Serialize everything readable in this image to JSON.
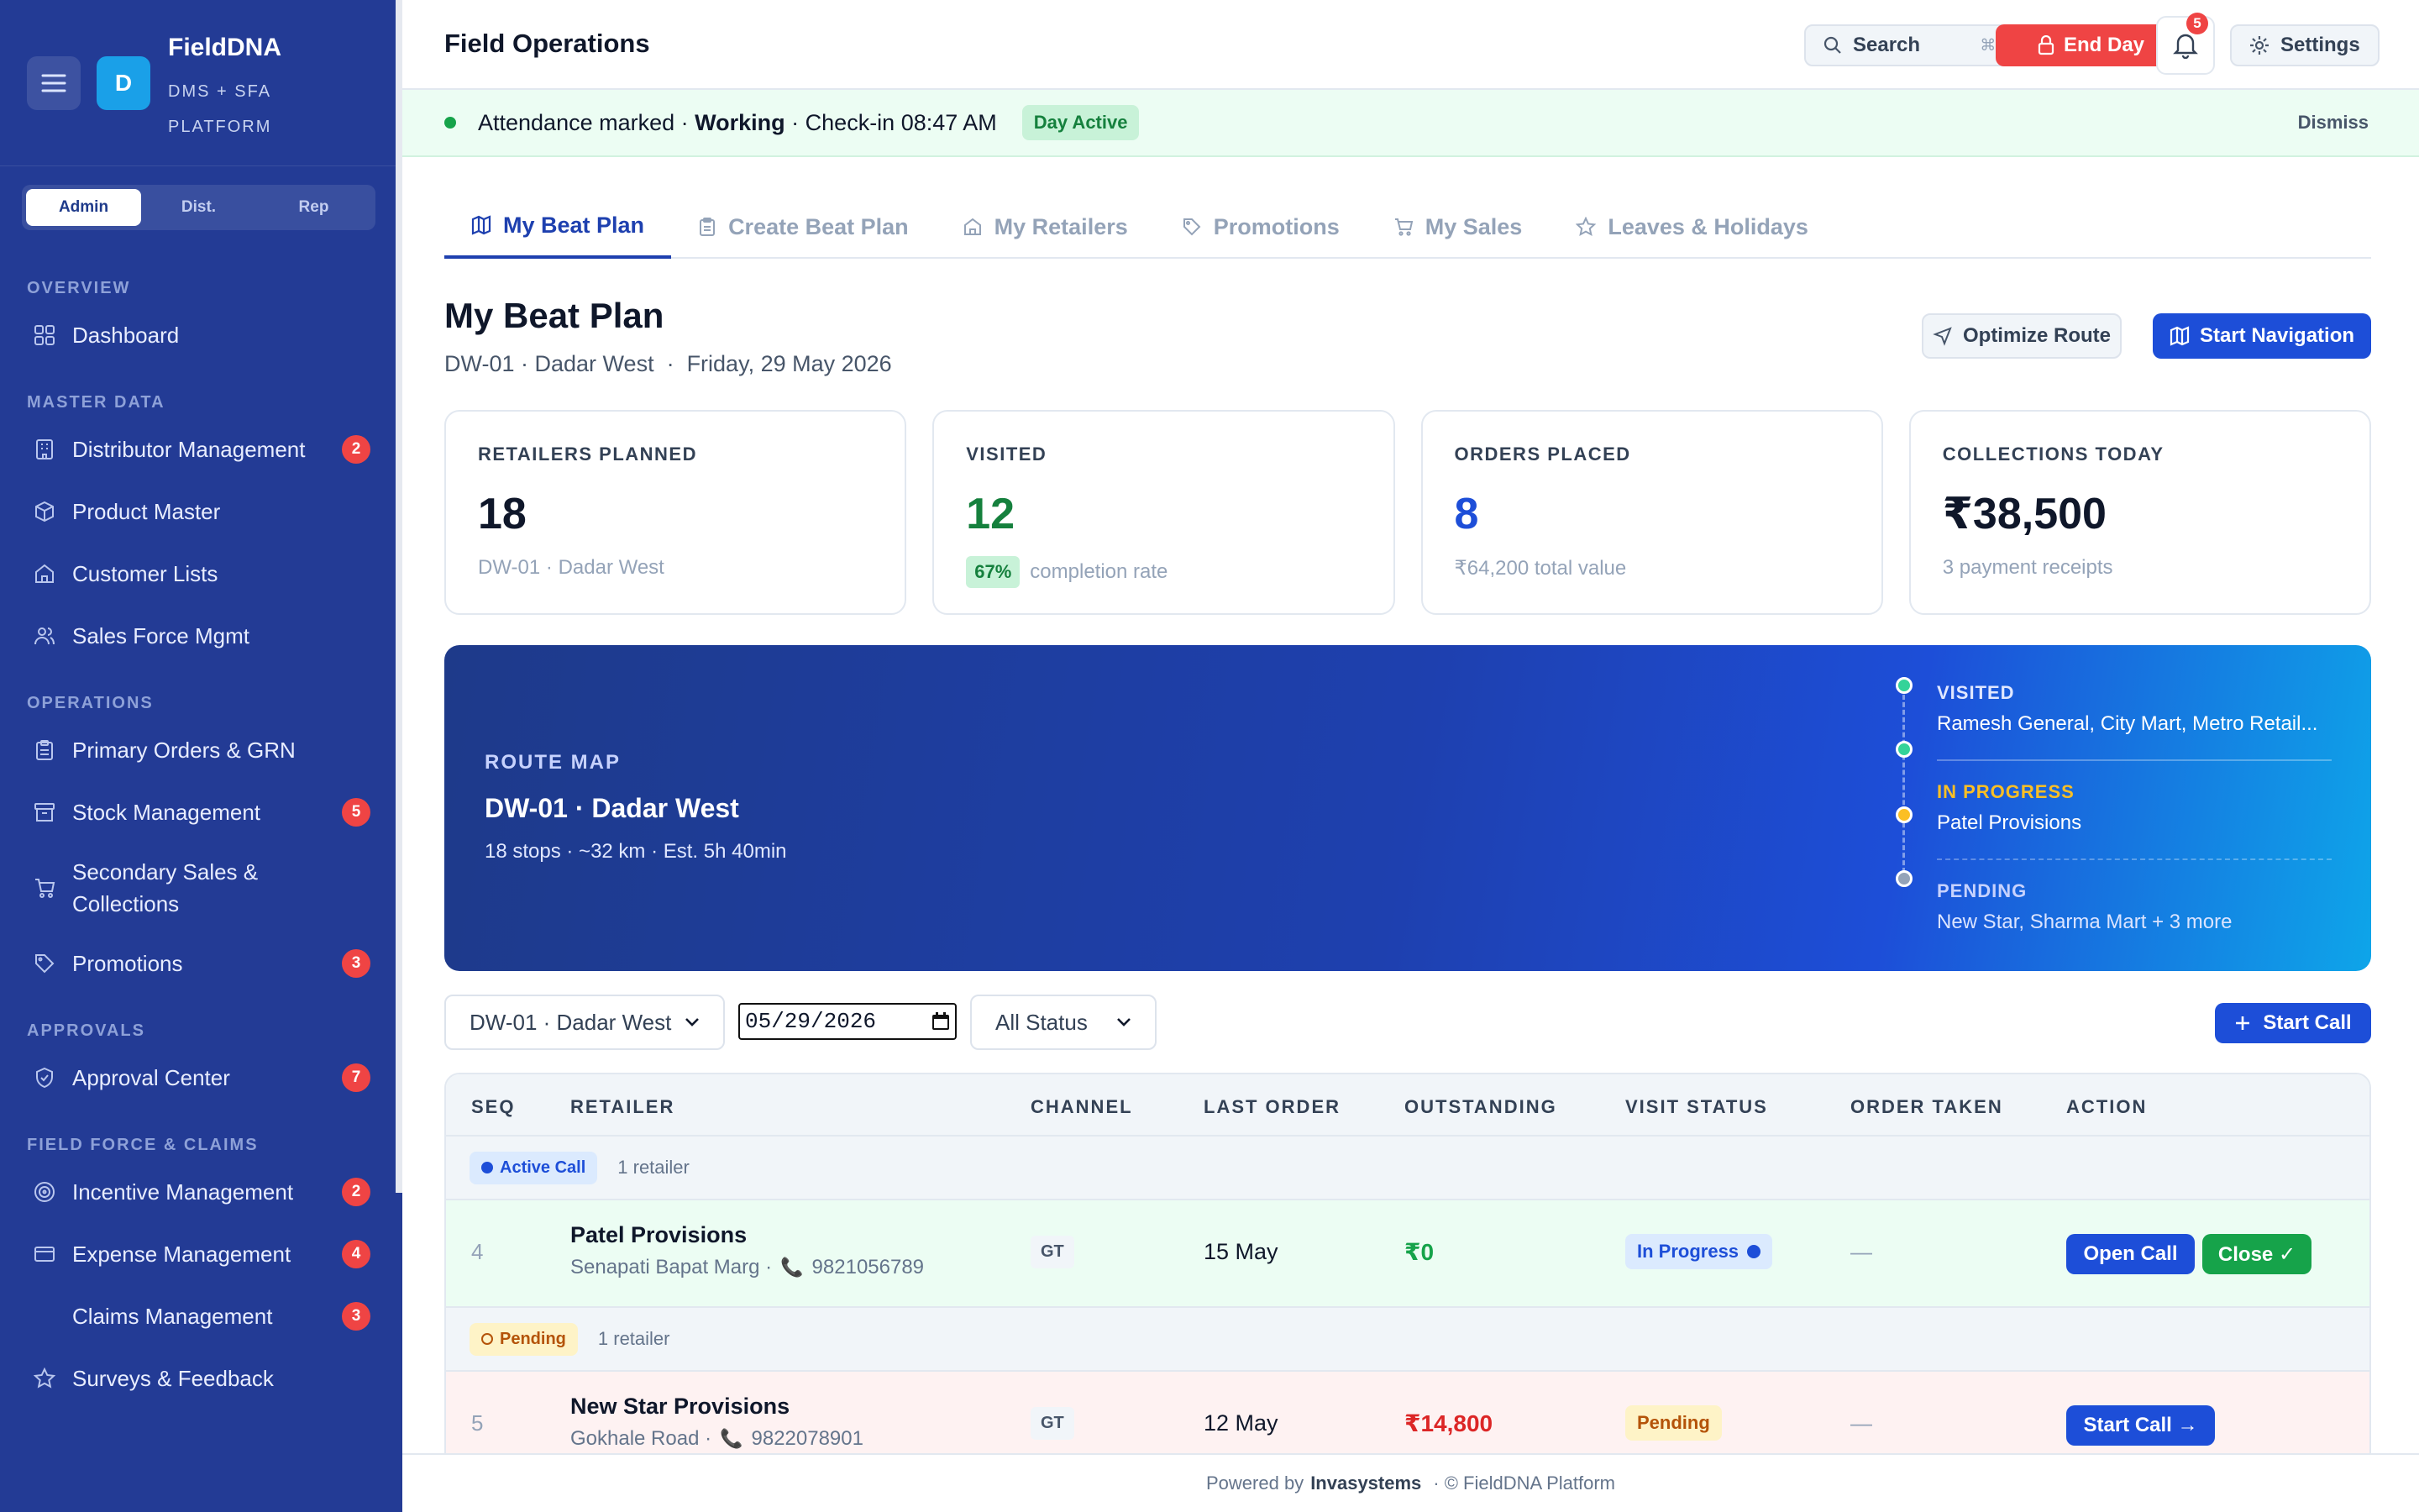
{
  "app": {
    "name": "FieldDNA",
    "subtitle": "DMS + SFA PLATFORM",
    "logo_letter": "D"
  },
  "roles": [
    "Admin",
    "Dist.",
    "Rep"
  ],
  "active_role": "Admin",
  "sidebar": {
    "sections": [
      {
        "title": "OVERVIEW",
        "items": [
          {
            "label": "Dashboard",
            "icon": "grid-icon"
          }
        ]
      },
      {
        "title": "MASTER DATA",
        "items": [
          {
            "label": "Distributor Management",
            "icon": "building-icon",
            "badge": "2"
          },
          {
            "label": "Product Master",
            "icon": "box-icon"
          },
          {
            "label": "Customer Lists",
            "icon": "store-icon"
          },
          {
            "label": "Sales Force Mgmt",
            "icon": "users-icon"
          }
        ]
      },
      {
        "title": "OPERATIONS",
        "items": [
          {
            "label": "Primary Orders & GRN",
            "icon": "clipboard-icon"
          },
          {
            "label": "Stock Management",
            "icon": "archive-icon",
            "badge": "5"
          },
          {
            "label": "Secondary Sales & Collections",
            "icon": "cart-icon"
          },
          {
            "label": "Promotions",
            "icon": "tag-icon",
            "badge": "3"
          }
        ]
      },
      {
        "title": "APPROVALS",
        "items": [
          {
            "label": "Approval Center",
            "icon": "shield-icon",
            "badge": "7"
          }
        ]
      },
      {
        "title": "FIELD FORCE & CLAIMS",
        "items": [
          {
            "label": "Incentive Management",
            "icon": "target-icon",
            "badge": "2"
          },
          {
            "label": "Expense Management",
            "icon": "card-icon",
            "badge": "4"
          },
          {
            "label": "Claims Management",
            "icon": "none",
            "badge": "3"
          },
          {
            "label": "Surveys & Feedback",
            "icon": "star-icon"
          }
        ]
      }
    ]
  },
  "topbar": {
    "title": "Field Operations",
    "search_label": "Search",
    "search_shortcut": "⌘K",
    "end_day_label": "End Day",
    "notification_count": "5",
    "settings_label": "Settings"
  },
  "banner": {
    "prefix": "Attendance marked ·",
    "status": "Working",
    "suffix": "· Check-in 08:47 AM",
    "chip": "Day Active",
    "dismiss": "Dismiss"
  },
  "tabs": [
    {
      "label": "My Beat Plan",
      "icon": "map-icon"
    },
    {
      "label": "Create Beat Plan",
      "icon": "clipboard-icon"
    },
    {
      "label": "My Retailers",
      "icon": "store-icon"
    },
    {
      "label": "Promotions",
      "icon": "tag-icon"
    },
    {
      "label": "My Sales",
      "icon": "cart-icon"
    },
    {
      "label": "Leaves & Holidays",
      "icon": "star-icon"
    }
  ],
  "page": {
    "title": "My Beat Plan",
    "subtitle": "DW-01 · Dadar West  ·  Friday, 29 May 2026",
    "optimize_label": "Optimize Route",
    "start_nav_label": "Start Navigation"
  },
  "stats": [
    {
      "label": "RETAILERS PLANNED",
      "value": "18",
      "desc": "DW-01 · Dadar West",
      "color": "#0f172a"
    },
    {
      "label": "VISITED",
      "value": "12",
      "pct": "67%",
      "desc": "completion rate",
      "color": "#15803d"
    },
    {
      "label": "ORDERS PLACED",
      "value": "8",
      "desc": "₹64,200 total value",
      "color": "#1d4ed8"
    },
    {
      "label": "COLLECTIONS TODAY",
      "value": "₹38,500",
      "desc": "3 payment receipts",
      "color": "#0f172a"
    }
  ],
  "route": {
    "label": "ROUTE MAP",
    "title": "DW-01 · Dadar West",
    "summary": "18 stops · ~32 km · Est. 5h 40min",
    "timeline": [
      {
        "key": "VISITED",
        "value": "Ramesh General, City Mart, Metro Retail...",
        "color": "#ffffff",
        "dot": "#34d399"
      },
      {
        "key": "IN PROGRESS",
        "value": "Patel Provisions",
        "color": "#fbbf24",
        "dot": "#fbbf24"
      },
      {
        "key": "PENDING",
        "value": "New Star, Sharma Mart + 3 more",
        "color": "#cbd5e1",
        "dot": "#94a3b8"
      }
    ]
  },
  "filters": {
    "beat": "DW-01 · Dadar West",
    "date": "05/29/2026",
    "status": "All Status",
    "start_call": "Start Call"
  },
  "table": {
    "headers": [
      "SEQ",
      "RETAILER",
      "CHANNEL",
      "LAST ORDER",
      "OUTSTANDING",
      "VISIT STATUS",
      "ORDER TAKEN",
      "ACTION"
    ],
    "groups": [
      {
        "chip": "Active Call",
        "count": "1 retailer",
        "row": {
          "seq": "4",
          "name": "Patel Provisions",
          "address": "Senapati Bapat Marg ·",
          "phone": "9821056789",
          "channel": "GT",
          "last_order": "15 May",
          "outstanding": "₹0",
          "visit_status": "In Progress",
          "order_taken": "—",
          "actions": [
            "Open Call",
            "Close ✓"
          ]
        }
      },
      {
        "chip": "Pending",
        "count": "1 retailer",
        "row": {
          "seq": "5",
          "name": "New Star Provisions",
          "address": "Gokhale Road ·",
          "phone": "9822078901",
          "channel": "GT",
          "last_order": "12 May",
          "outstanding": "₹14,800",
          "visit_status": "Pending",
          "order_taken": "—",
          "actions": [
            "Start Call →"
          ]
        }
      }
    ]
  },
  "footer": {
    "prefix": "Powered by",
    "brand": "Invasystems",
    "suffix": "·  © FieldDNA Platform"
  }
}
